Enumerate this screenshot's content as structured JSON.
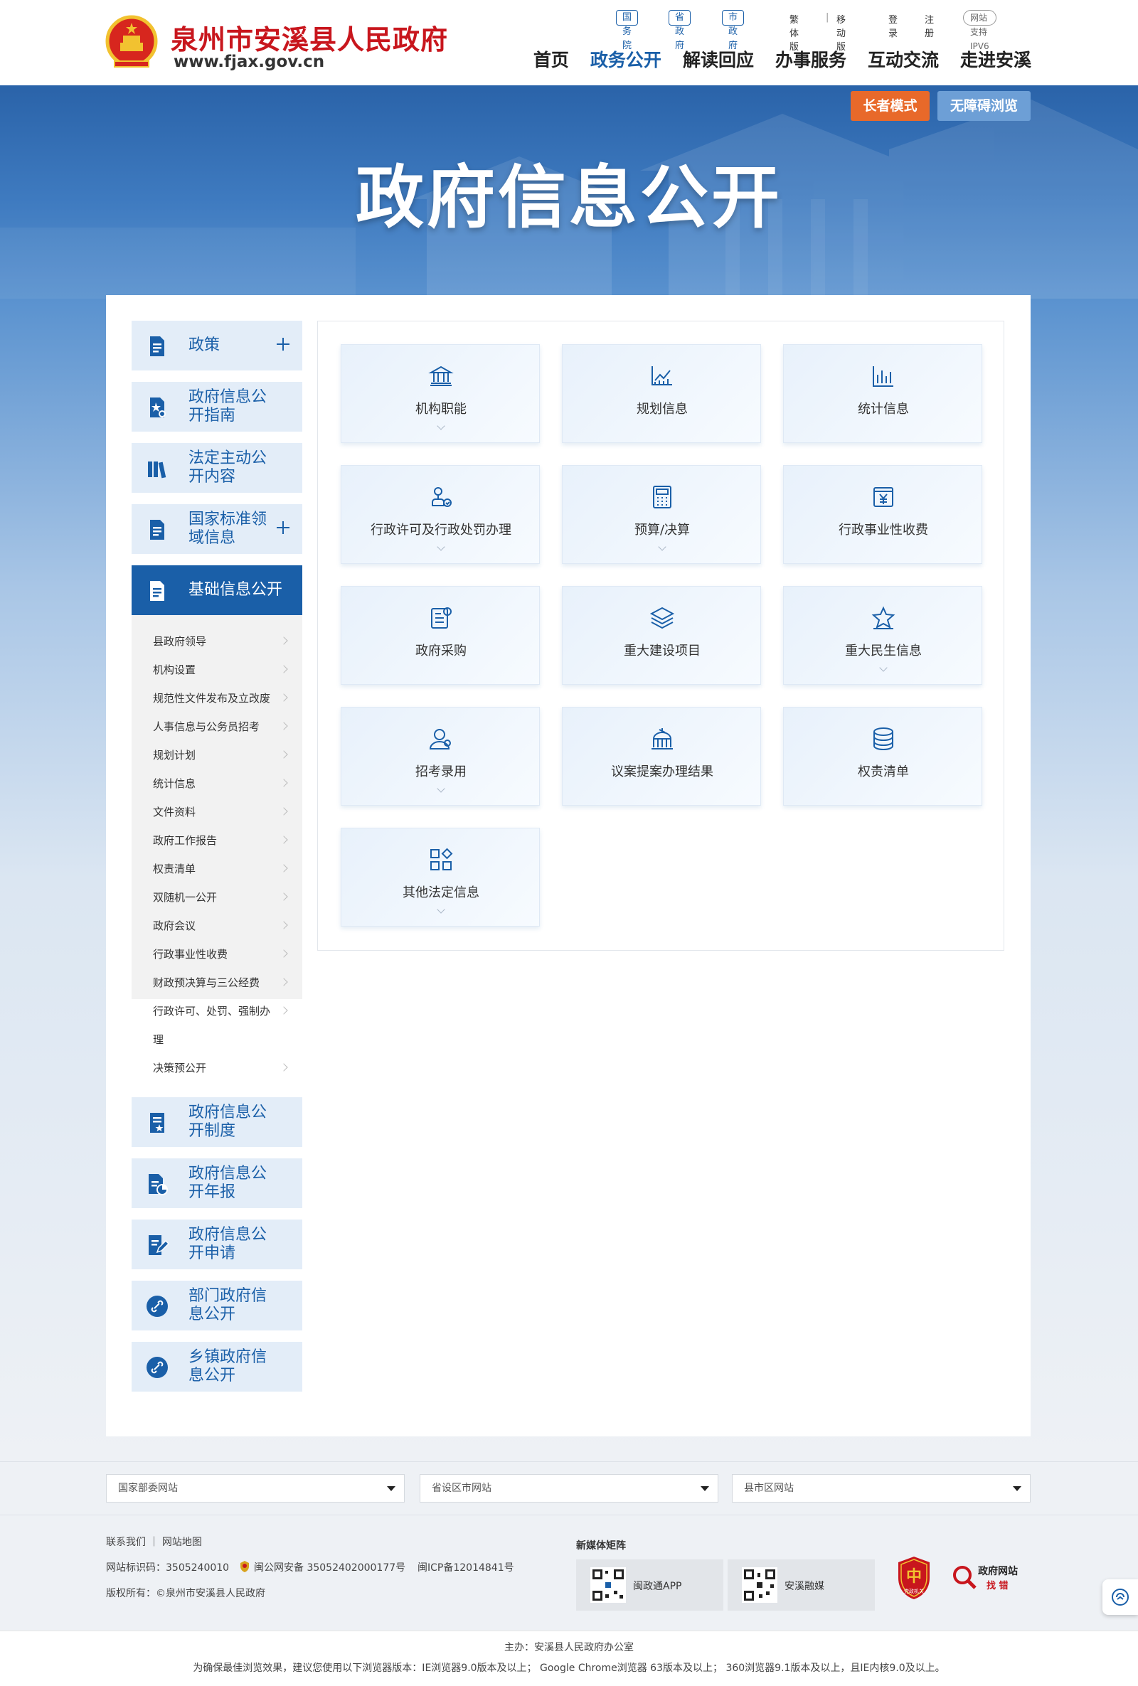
{
  "header": {
    "site_name": "泉州市安溪县人民政府",
    "site_url": "www.fjax.gov.cn",
    "top_pills": [
      "国务院",
      "省政府",
      "市政府"
    ],
    "top_links": [
      "繁体版",
      "移动版",
      "登录",
      "注册"
    ],
    "ipv6": "网站支持IPV6",
    "main_nav": [
      "首页",
      "政务公开",
      "解读回应",
      "办事服务",
      "互动交流",
      "走进安溪"
    ],
    "active_nav": "政务公开"
  },
  "banner": {
    "title": "政府信息公开",
    "elder_mode": "长者模式",
    "accessible": "无障碍浏览"
  },
  "sidebar": {
    "items": [
      {
        "label": "政策",
        "icon": "document-icon"
      },
      {
        "label": "政府信息公开指南",
        "icon": "guide-icon"
      },
      {
        "label": "法定主动公开内容",
        "icon": "books-icon"
      },
      {
        "label": "国家标准领域信息",
        "icon": "document-icon"
      },
      {
        "label": "基础信息公开",
        "icon": "document-icon"
      }
    ],
    "sub_items": [
      "县政府领导",
      "机构设置",
      "规范性文件发布及立改废",
      "人事信息与公务员招考",
      "规划计划",
      "统计信息",
      "文件资料",
      "政府工作报告",
      "权责清单",
      "双随机一公开",
      "政府会议",
      "行政事业性收费",
      "财政预决算与三公经费",
      "行政许可、处罚、强制办",
      "理",
      "决策预公开"
    ],
    "lower_items": [
      {
        "label": "政府信息公开制度",
        "icon": "rules-icon"
      },
      {
        "label": "政府信息公开年报",
        "icon": "report-icon"
      },
      {
        "label": "政府信息公开申请",
        "icon": "apply-icon"
      },
      {
        "label": "部门政府信息公开",
        "icon": "link-icon"
      },
      {
        "label": "乡镇政府信息公开",
        "icon": "link-icon"
      }
    ]
  },
  "cards": [
    {
      "label": "机构职能",
      "icon": "institution-icon",
      "expand": true
    },
    {
      "label": "规划信息",
      "icon": "planning-icon",
      "expand": false
    },
    {
      "label": "统计信息",
      "icon": "statistics-icon",
      "expand": false
    },
    {
      "label": "行政许可及行政处罚办理",
      "icon": "permit-icon",
      "expand": true
    },
    {
      "label": "预算/决算",
      "icon": "calculator-icon",
      "expand": true
    },
    {
      "label": "行政事业性收费",
      "icon": "fee-icon",
      "expand": false
    },
    {
      "label": "政府采购",
      "icon": "procurement-icon",
      "expand": false
    },
    {
      "label": "重大建设项目",
      "icon": "layers-icon",
      "expand": false
    },
    {
      "label": "重大民生信息",
      "icon": "star-icon",
      "expand": true
    },
    {
      "label": "招考录用",
      "icon": "recruit-icon",
      "expand": true
    },
    {
      "label": "议案提案办理结果",
      "icon": "proposal-icon",
      "expand": false
    },
    {
      "label": "权责清单",
      "icon": "database-icon",
      "expand": false
    },
    {
      "label": "其他法定信息",
      "icon": "grid-icon",
      "expand": true
    }
  ],
  "link_selects": [
    "国家部委网站",
    "省设区市网站",
    "县市区网站"
  ],
  "footer": {
    "links": "联系我们 ｜ 网站地图",
    "site_id": "网站标识码：3505240010",
    "police": "闽公网安备 35052402000177号",
    "icp": "闽ICP备12014841号",
    "copyright": "版权所有：©泉州市安溪县人民政府",
    "new_media": "新媒体矩阵",
    "qr_items": [
      "闽政通APP",
      "安溪融媒"
    ],
    "sponsor": "主办：安溪县人民政府办公室",
    "browser_note": "为确保最佳浏览效果，建议您使用以下浏览器版本：IE浏览器9.0版本及以上； Google Chrome浏览器 63版本及以上； 360浏览器9.1版本及以上，且IE内核9.0及以上。",
    "badge_gov_l1": "政府网站",
    "badge_gov_l2": "找 错",
    "badge_red": "党政机关"
  },
  "colors": {
    "brand_blue": "#1a5fa8",
    "brand_red": "#c8161d",
    "elder_orange": "#e8692a"
  }
}
